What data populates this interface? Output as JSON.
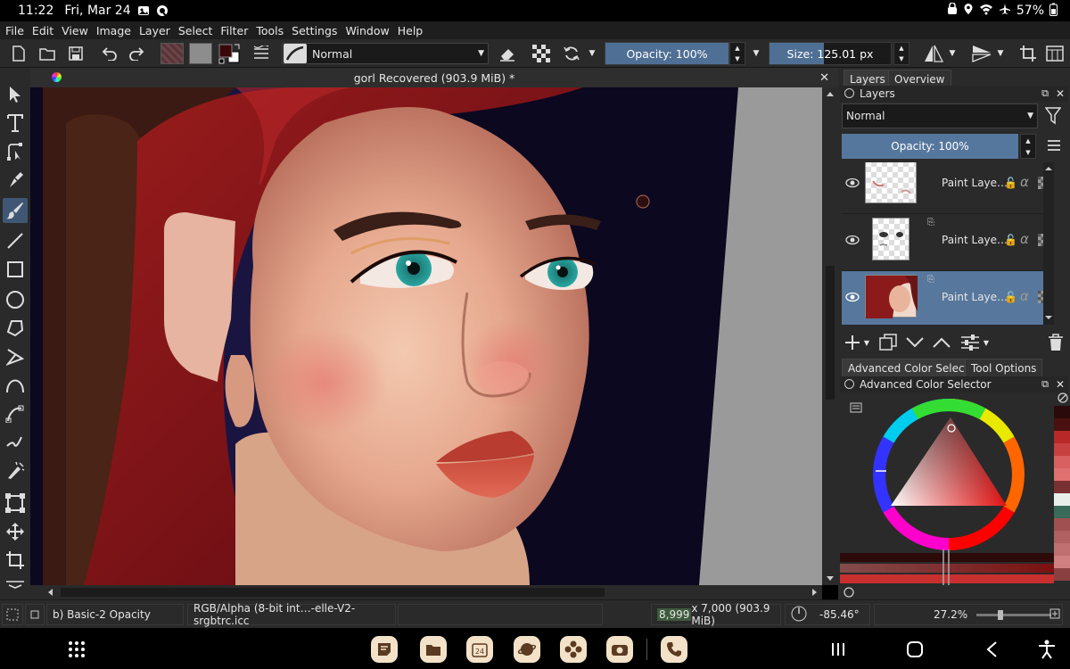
{
  "android_status": {
    "time": "11:22",
    "date": "Fri, Mar 24",
    "battery": "57%"
  },
  "menu": [
    "File",
    "Edit",
    "View",
    "Image",
    "Layer",
    "Select",
    "Filter",
    "Tools",
    "Settings",
    "Window",
    "Help"
  ],
  "toolbar": {
    "blend_mode": "Normal",
    "opacity_label": "Opacity: 100%",
    "opacity_value": 1.0,
    "size_label": "Size: 125.01 px",
    "size_fill": 0.45
  },
  "document": {
    "title": "gorl Recovered  (903.9 MiB)  *"
  },
  "docker": {
    "tabs": [
      "Layers",
      "Overview"
    ],
    "layers_title": "Layers",
    "blend_mode": "Normal",
    "opacity_label": "Opacity:  100%",
    "layers": [
      {
        "name": "Paint Laye…",
        "selected": false
      },
      {
        "name": "Paint Laye…",
        "selected": false
      },
      {
        "name": "Paint Laye…",
        "selected": true
      }
    ],
    "color_tabs": [
      "Advanced Color Selector",
      "Tool Options"
    ],
    "color_title": "Advanced Color Selector"
  },
  "status": {
    "brush": "b) Basic-2 Opacity",
    "colorspace": "RGB/Alpha (8-bit int…-elle-V2-srgbtrc.icc",
    "dimensions_w": "8,999",
    "dimensions_rest": " x 7,000 (903.9 MiB)",
    "rotation": "-85.46°",
    "zoom": "27.2%"
  },
  "colors": {
    "accent": "#4f6f94",
    "selected_row": "#57779c",
    "panel": "#2a2a2a"
  },
  "icons": {
    "tools": [
      "select-shapes-icon",
      "text-icon",
      "edit-shapes-icon",
      "calligraphy-icon",
      "freehand-brush-icon",
      "line-icon",
      "rectangle-icon",
      "ellipse-icon",
      "polygon-icon",
      "polyline-icon",
      "bezier-icon",
      "freehand-path-icon",
      "dynamic-brush-icon",
      "transform-icon",
      "move-icon",
      "crop-icon"
    ]
  }
}
